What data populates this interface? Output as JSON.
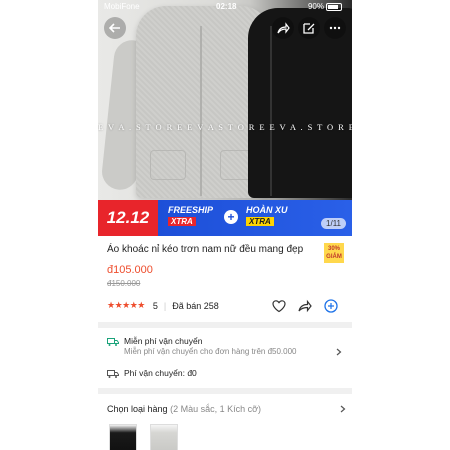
{
  "status_bar": {
    "carrier": "MobiFone",
    "time": "02:18",
    "battery": "90%"
  },
  "hero": {
    "watermark": "E V A . S T O R E   E V A S T O R E E V A . S T O R E   E V A . S T",
    "pager": "1/11"
  },
  "banner": {
    "date": "12.12",
    "freeship": "FREESHIP",
    "freeship_tag": "XTRA",
    "hoanxu": "HOÀN XU",
    "hoanxu_tag": "XTRA",
    "plus": "+"
  },
  "product": {
    "title": "Áo khoác nỉ kéo trơn nam nữ đều mang đẹp",
    "discount_badge_top": "30%",
    "discount_badge_bottom": "GIẢM",
    "price": "đ105.000",
    "old_price": "đ150.000",
    "stars": "★★★★★",
    "rating": "5",
    "sold": "Đã bán 258"
  },
  "shipping": {
    "free_title": "Miễn phí vận chuyển",
    "free_sub": "Miễn phí vận chuyển cho đơn hàng trên đ50.000",
    "fee": "Phí vận chuyển: đ0"
  },
  "variants": {
    "label": "Chọn loại hàng",
    "detail": "(2 Màu sắc, 1 Kích cỡ)"
  },
  "colors": {
    "accent": "#ee4d2d",
    "banner_blue": "#1d4fd8",
    "banner_red": "#e8252b"
  }
}
